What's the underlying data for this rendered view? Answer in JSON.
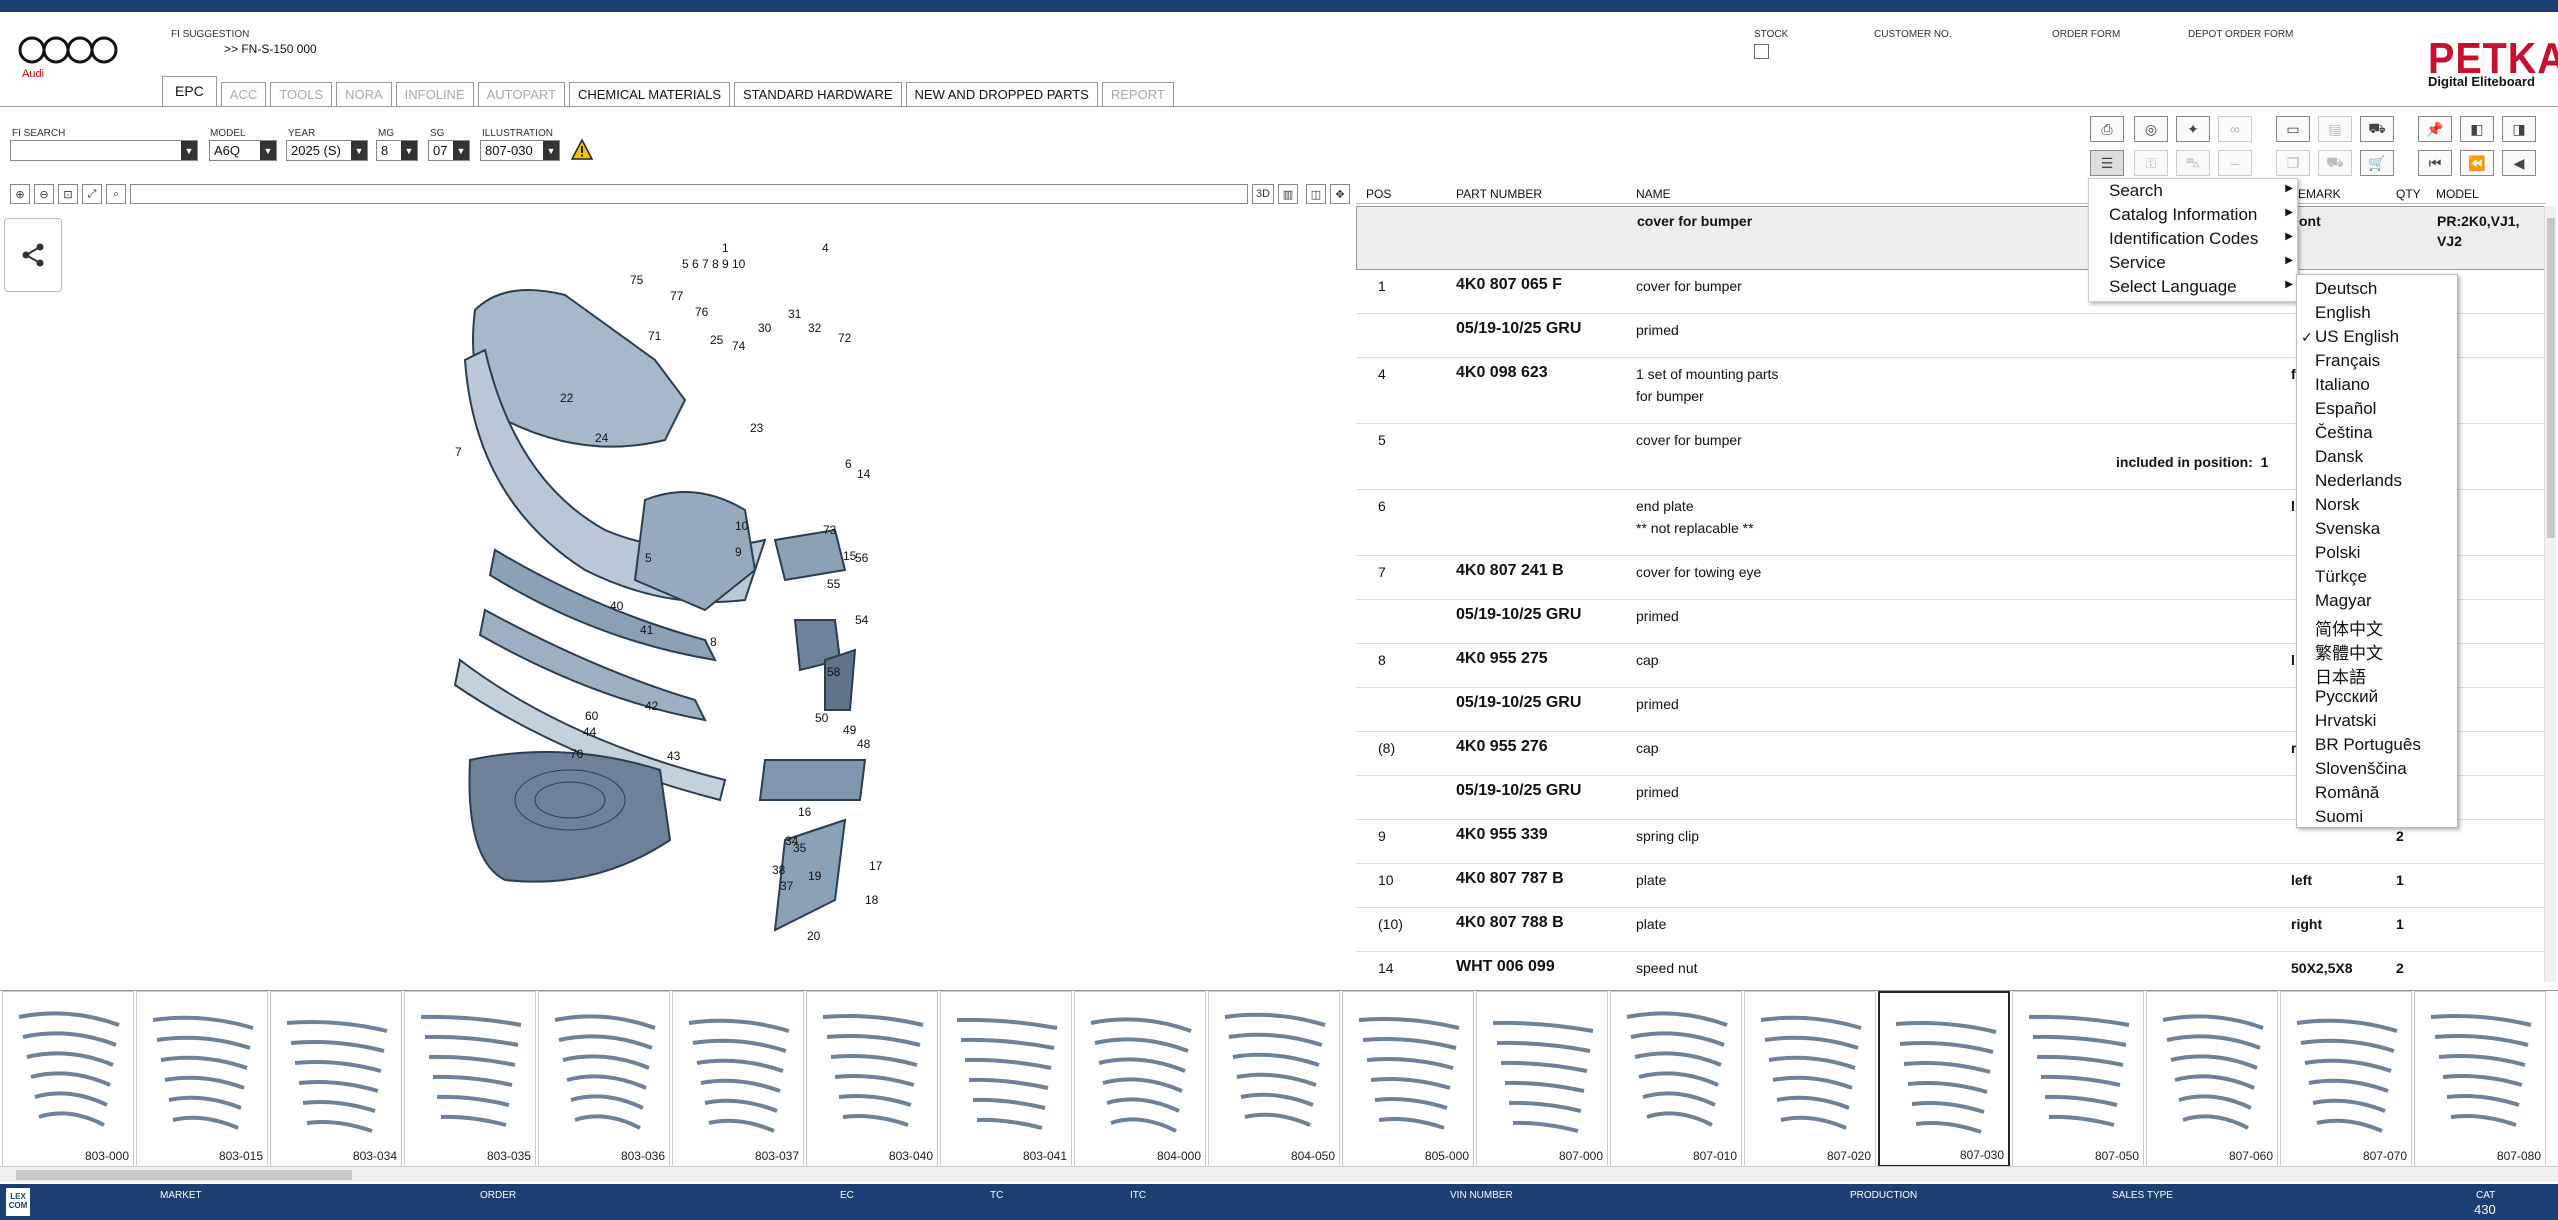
{
  "header": {
    "brand": "Audi",
    "fi_suggestion_label": "FI SUGGESTION",
    "fi_suggestion_value": ">> FN-S-150 000",
    "stock_label": "STOCK",
    "customer_no_label": "CUSTOMER NO.",
    "order_form_label": "ORDER FORM",
    "depot_order_form_label": "DEPOT ORDER FORM",
    "petka_title": "PETKA",
    "petka_subtitle": "Digital Eliteboard"
  },
  "tabs": [
    {
      "label": "EPC",
      "active": true,
      "disabled": false
    },
    {
      "label": "ACC",
      "disabled": true
    },
    {
      "label": "TOOLS",
      "disabled": true
    },
    {
      "label": "NORA",
      "disabled": true
    },
    {
      "label": "INFOLINE",
      "disabled": true
    },
    {
      "label": "AUTOPART",
      "disabled": true
    },
    {
      "label": "CHEMICAL MATERIALS",
      "disabled": false
    },
    {
      "label": "STANDARD HARDWARE",
      "disabled": false
    },
    {
      "label": "NEW AND DROPPED PARTS",
      "disabled": false
    },
    {
      "label": "REPORT",
      "disabled": true
    }
  ],
  "filters": {
    "fi_search_label": "FI SEARCH",
    "fi_search_value": "",
    "model_label": "MODEL",
    "model_value": "A6Q",
    "year_label": "YEAR",
    "year_value": "2025 (S)",
    "mg_label": "MG",
    "mg_value": "8",
    "sg_label": "SG",
    "sg_value": "07",
    "illustration_label": "ILLUSTRATION",
    "illustration_value": "807-030"
  },
  "parts_table": {
    "headers": {
      "pos": "POS",
      "part_number": "PART NUMBER",
      "name": "NAME",
      "remark": "EMARK",
      "qty": "QTY",
      "model": "MODEL"
    },
    "group_row": {
      "name": "cover for bumper",
      "remark": "ont",
      "model_line1": "PR:2K0,VJ1,",
      "model_line2": "VJ2"
    },
    "rows": [
      {
        "pos": "1",
        "pn": "4K0 807 065 F",
        "name": "cover for bumper",
        "name2": "",
        "remark": "",
        "qty": "",
        "model": "",
        "extra": ""
      },
      {
        "pos": "",
        "pn": "05/19-10/25 GRU",
        "name": "primed",
        "name2": "",
        "remark": "",
        "qty": "",
        "model": "",
        "extra": ""
      },
      {
        "pos": "4",
        "pn": "4K0 098 623",
        "name": "1 set of mounting parts",
        "name2": "for bumper",
        "remark": "f",
        "qty": "",
        "model": "",
        "extra": ""
      },
      {
        "pos": "5",
        "pn": "",
        "name": "cover for bumper",
        "name2": "",
        "remark": "",
        "qty": "",
        "model": "",
        "extra": "included in position:  1"
      },
      {
        "pos": "6",
        "pn": "",
        "name": "end plate",
        "name2": "** not replacable **",
        "remark": "l",
        "qty": "",
        "model": "",
        "extra": ""
      },
      {
        "pos": "7",
        "pn": "4K0 807 241 B",
        "name": "cover for towing eye",
        "name2": "",
        "remark": "",
        "qty": "",
        "model": "",
        "extra": ""
      },
      {
        "pos": "",
        "pn": "05/19-10/25 GRU",
        "name": "primed",
        "name2": "",
        "remark": "",
        "qty": "",
        "model": "",
        "extra": ""
      },
      {
        "pos": "8",
        "pn": "4K0 955 275",
        "name": "cap",
        "name2": "",
        "remark": "l",
        "qty": "",
        "model": "",
        "extra": ""
      },
      {
        "pos": "",
        "pn": "05/19-10/25 GRU",
        "name": "primed",
        "name2": "",
        "remark": "",
        "qty": "",
        "model": "",
        "extra": ""
      },
      {
        "pos": "(8)",
        "pn": "4K0 955 276",
        "name": "cap",
        "name2": "",
        "remark": "r",
        "qty": "",
        "model": "",
        "extra": ""
      },
      {
        "pos": "",
        "pn": "05/19-10/25 GRU",
        "name": "primed",
        "name2": "",
        "remark": "",
        "qty": "",
        "model": "",
        "extra": ""
      },
      {
        "pos": "9",
        "pn": "4K0 955 339",
        "name": "spring clip",
        "name2": "",
        "remark": "",
        "qty": "2",
        "model": "",
        "extra": ""
      },
      {
        "pos": "10",
        "pn": "4K0 807 787 B",
        "name": "plate",
        "name2": "",
        "remark": "left",
        "qty": "1",
        "model": "",
        "extra": ""
      },
      {
        "pos": "(10)",
        "pn": "4K0 807 788 B",
        "name": "plate",
        "name2": "",
        "remark": "right",
        "qty": "1",
        "model": "",
        "extra": ""
      },
      {
        "pos": "14",
        "pn": "WHT 006 099",
        "name": "speed nut",
        "name2": "",
        "remark": "50X2,5X8",
        "qty": "2",
        "model": "",
        "extra": ""
      }
    ]
  },
  "context_menu": {
    "items": [
      "Search",
      "Catalog Information",
      "Identification Codes",
      "Service",
      "Select Language"
    ]
  },
  "language_menu": {
    "selected": "US English",
    "items": [
      "Deutsch",
      "English",
      "US English",
      "Français",
      "Italiano",
      "Español",
      "Čeština",
      "Dansk",
      "Nederlands",
      "Norsk",
      "Svenska",
      "Polski",
      "Türkçe",
      "Magyar",
      "简体中文",
      "繁體中文",
      "日本語",
      "Русский",
      "Hrvatski",
      "BR Português",
      "Slovenščina",
      "Română",
      "Suomi"
    ]
  },
  "diagram_callouts": [
    "1",
    "5",
    "6",
    "7",
    "8",
    "9",
    "10",
    "4",
    "75",
    "77",
    "76",
    "31",
    "32",
    "72",
    "30",
    "71",
    "25",
    "74",
    "22",
    "23",
    "24",
    "7",
    "6",
    "14",
    "10",
    "73",
    "9",
    "15",
    "56",
    "5",
    "55",
    "54",
    "40",
    "41",
    "8",
    "58",
    "50",
    "49",
    "48",
    "42",
    "60",
    "44",
    "43",
    "70",
    "16",
    "34",
    "35",
    "17",
    "38",
    "19",
    "37",
    "18",
    "20"
  ],
  "thumbnails": [
    "803-000",
    "803-015",
    "803-034",
    "803-035",
    "803-036",
    "803-037",
    "803-040",
    "803-041",
    "804-000",
    "804-050",
    "805-000",
    "807-000",
    "807-010",
    "807-020",
    "807-030",
    "807-050",
    "807-060",
    "807-070",
    "807-080"
  ],
  "selected_thumbnail": "807-030",
  "statusbar": {
    "lexcom": "LEX COM",
    "market": "MARKET",
    "order": "ORDER",
    "ec": "EC",
    "tc": "TC",
    "itc": "ITC",
    "vin": "VIN NUMBER",
    "production": "PRODUCTION",
    "sales_type": "SALES TYPE",
    "cat_label": "CAT",
    "cat_value": "430"
  }
}
